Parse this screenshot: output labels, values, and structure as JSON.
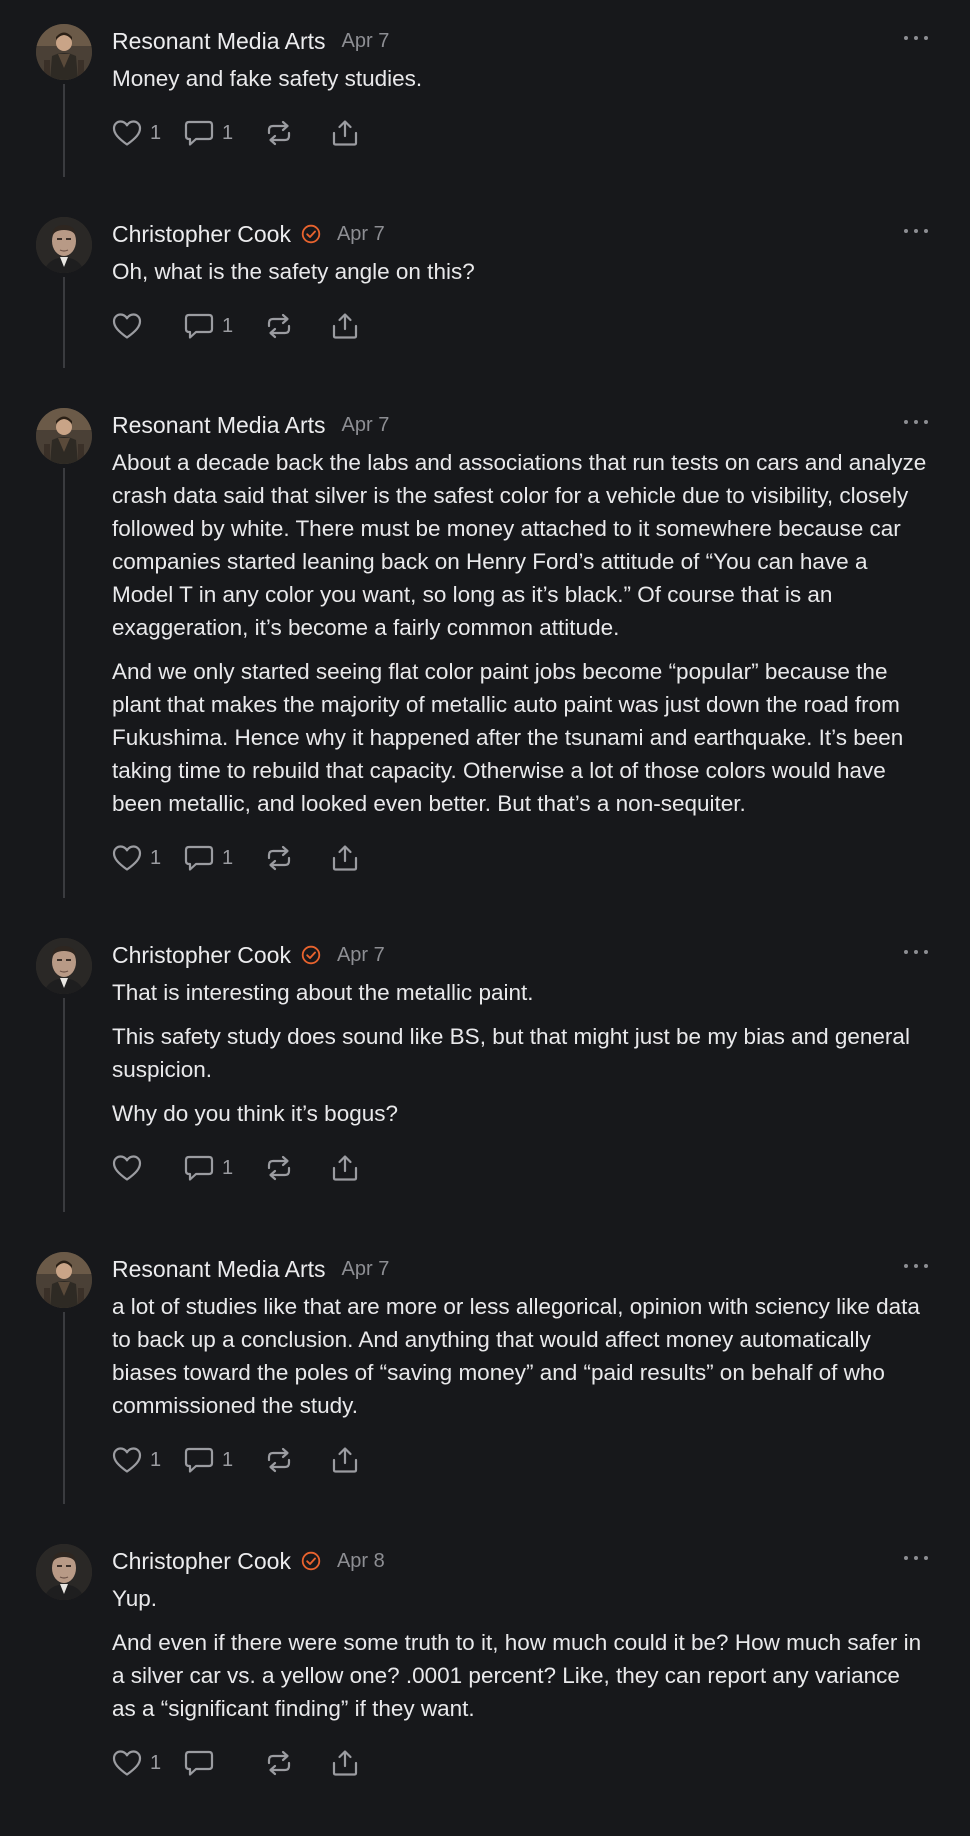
{
  "colors": {
    "background": "#17181b",
    "text": "#e9e9eb",
    "muted": "#8d8e93",
    "verified": "#e8632e",
    "thread_line": "#3a3b3f"
  },
  "comments": [
    {
      "author": "Resonant Media Arts",
      "verified": false,
      "date": "Apr 7",
      "paragraphs": [
        "Money and fake safety studies."
      ],
      "like_count": "1",
      "comment_count": "1"
    },
    {
      "author": "Christopher Cook",
      "verified": true,
      "date": "Apr 7",
      "paragraphs": [
        "Oh, what is the safety angle on this?"
      ],
      "like_count": "",
      "comment_count": "1"
    },
    {
      "author": "Resonant Media Arts",
      "verified": false,
      "date": "Apr 7",
      "paragraphs": [
        "About a decade back the labs and associations that run tests on cars and analyze crash data said that silver is the safest color for a vehicle due to visibility, closely followed by white. There must be money attached to it somewhere because car companies started leaning back on Henry Ford’s attitude of “You can have a Model T in any color you want, so long as it’s black.” Of course that is an exaggeration, it’s become a fairly common attitude.",
        "And we only started seeing flat color paint jobs become “popular” because the plant that makes the majority of metallic auto paint was just down the road from Fukushima. Hence why it happened after the tsunami and earthquake. It’s been taking time to rebuild that capacity. Otherwise a lot of those colors would have been metallic, and looked even better. But that’s a non-sequiter."
      ],
      "like_count": "1",
      "comment_count": "1"
    },
    {
      "author": "Christopher Cook",
      "verified": true,
      "date": "Apr 7",
      "paragraphs": [
        "That is interesting about the metallic paint.",
        "This safety study does sound like BS, but that might just be my bias and general suspicion.",
        "Why do you think it’s bogus?"
      ],
      "like_count": "",
      "comment_count": "1"
    },
    {
      "author": "Resonant Media Arts",
      "verified": false,
      "date": "Apr 7",
      "paragraphs": [
        "a lot of studies like that are more or less allegorical, opinion with sciency like data to back up a conclusion. And anything that would affect money automatically biases toward the poles of “saving money” and “paid results” on behalf of who commissioned the study."
      ],
      "like_count": "1",
      "comment_count": "1"
    },
    {
      "author": "Christopher Cook",
      "verified": true,
      "date": "Apr 8",
      "paragraphs": [
        "Yup.",
        "And even if there were some truth to it, how much could it be? How much safer in a silver car vs. a yellow one? .0001 percent? Like, they can report any variance as a “significant finding” if they want."
      ],
      "like_count": "1",
      "comment_count": ""
    }
  ]
}
